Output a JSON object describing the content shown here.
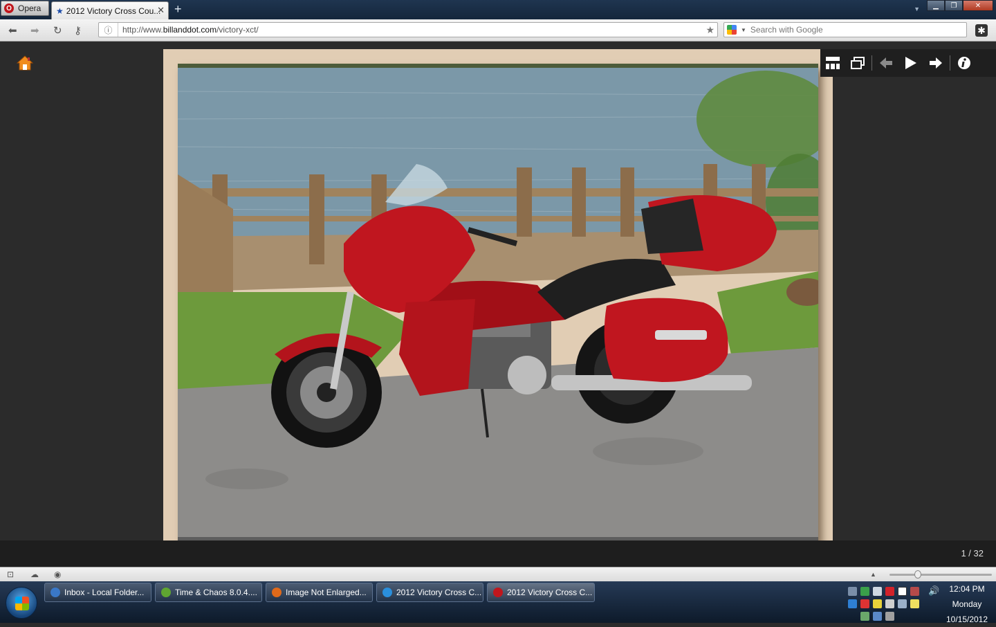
{
  "browser": {
    "menu_label": "Opera",
    "tab_title": "2012 Victory Cross Cou...",
    "url_prefix": "http://www.",
    "url_domain": "billanddot.com",
    "url_path": "/victory-xct/",
    "search_placeholder": "Search with Google"
  },
  "viewer": {
    "counter": "1 / 32",
    "icons": [
      "thumbnails-icon",
      "fullscreen-icon",
      "previous-icon",
      "play-icon",
      "next-icon",
      "info-icon"
    ]
  },
  "taskbar": {
    "items": [
      {
        "label": "Inbox - Local Folder...",
        "icon_color": "#3a78c8"
      },
      {
        "label": "Time & Chaos 8.0.4....",
        "icon_color": "#5fa531"
      },
      {
        "label": "Image Not Enlarged...",
        "icon_color": "#e06a1b"
      },
      {
        "label": "2012 Victory Cross C...",
        "icon_color": "#2a8fdc"
      },
      {
        "label": "2012 Victory Cross C...",
        "icon_color": "#c0171d"
      }
    ],
    "clock_time": "12:04 PM",
    "clock_day": "Monday",
    "clock_date": "10/15/2012"
  }
}
